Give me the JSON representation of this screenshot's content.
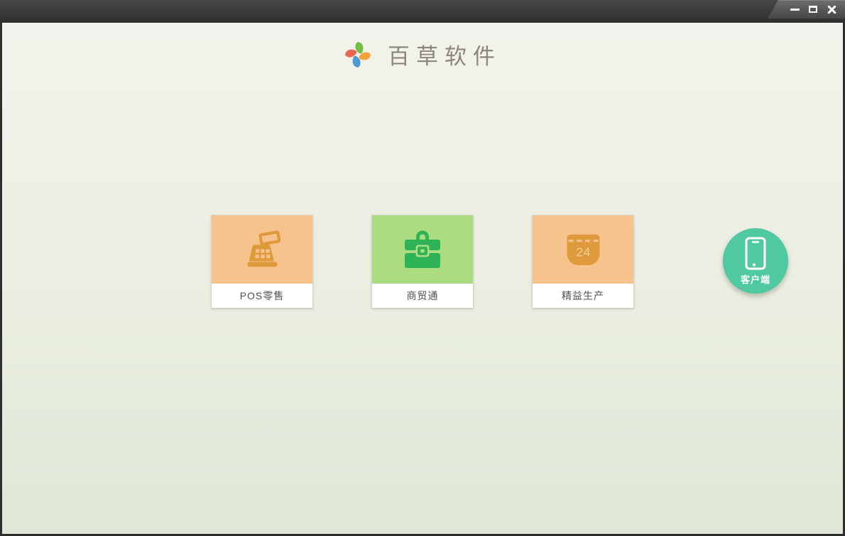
{
  "window": {
    "controls": {
      "minimize": "minimize",
      "maximize": "maximize",
      "close": "close"
    },
    "frame_color": "#2e2e2e",
    "titlebar_color": "#3a3a3a"
  },
  "brand": {
    "app_name": "百草软件",
    "logo_icon": "pinwheel-icon",
    "logo_petal_colors": {
      "top": "#72bf44",
      "right": "#f4a13a",
      "bottom": "#4e9ad5",
      "left": "#e8684f"
    }
  },
  "products": [
    {
      "label": "POS零售",
      "icon": "cash-register-icon",
      "tile_color": "#f6c38d",
      "icon_color": "#df9a3c"
    },
    {
      "label": "商贸通",
      "icon": "briefcase-icon",
      "tile_color": "#abdc80",
      "icon_color": "#2eb457"
    },
    {
      "label": "精益生产",
      "icon": "calendar-icon",
      "tile_color": "#f6c38d",
      "icon_color": "#df9a3c",
      "calendar_day": "24"
    }
  ],
  "client_button": {
    "label": "客户端",
    "icon": "smartphone-icon",
    "color": "#50c8a0"
  },
  "background": {
    "gradient_top": "#f3f2ec",
    "gradient_bottom": "#dfe7d7"
  }
}
